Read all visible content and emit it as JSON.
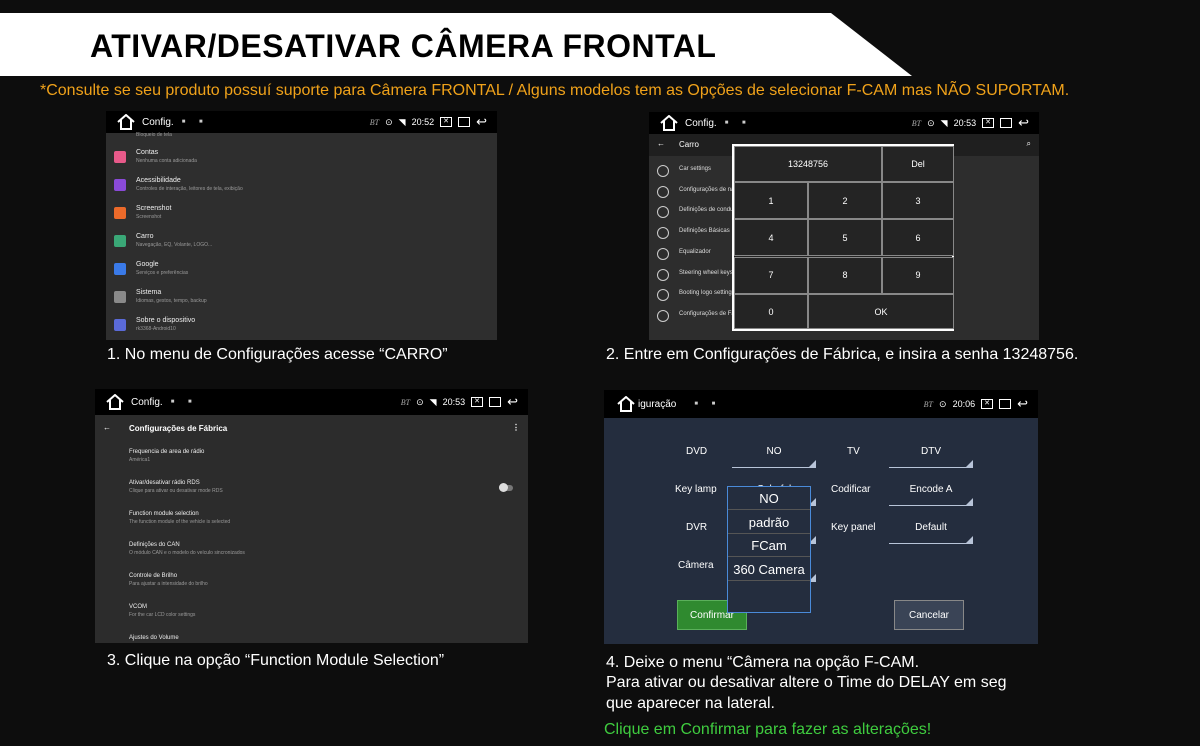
{
  "header": {
    "title": "ATIVAR/DESATIVAR CÂMERA FRONTAL",
    "notice": "*Consulte se seu produto possuí suporte para Câmera FRONTAL / Alguns modelos tem as Opções de selecionar F-CAM mas NÃO SUPORTAM."
  },
  "step1": {
    "status": {
      "title": "Config.",
      "time": "20:52",
      "bt": "BT"
    },
    "partial_top": "Bloqueio de tela",
    "items": [
      {
        "title": "Contas",
        "sub": "Nenhuma conta adicionada",
        "color": "#e85a8a"
      },
      {
        "title": "Acessibilidade",
        "sub": "Controles de interação, leitores de tela, exibição",
        "color": "#8a4ad8"
      },
      {
        "title": "Screenshot",
        "sub": "Screenshot",
        "color": "#ec6a2a"
      },
      {
        "title": "Carro",
        "sub": "Navegação, EQ, Volante, LOGO...",
        "color": "#3aa877"
      },
      {
        "title": "Google",
        "sub": "Serviços e preferências",
        "color": "#3a7ae8"
      },
      {
        "title": "Sistema",
        "sub": "Idiomas, gestos, tempo, backup",
        "color": "#8a8a8a"
      },
      {
        "title": "Sobre o dispositivo",
        "sub": "rk3368-Android10",
        "color": "#5a6ad8"
      }
    ],
    "caption": "1. No menu de Configurações acesse “CARRO”"
  },
  "step2": {
    "status": {
      "title": "Config.",
      "time": "20:53",
      "bt": "BT"
    },
    "header": "Carro",
    "items": [
      "Car settings",
      "Configurações de navegação",
      "Definições de condução",
      "Definições Básicas",
      "Equalizador",
      "Steering wheel keys",
      "Booting logo settings",
      "Configurações de Fábrica"
    ],
    "keypad": {
      "display": "13248756",
      "del": "Del",
      "keys": [
        "1",
        "2",
        "3",
        "4",
        "5",
        "6",
        "7",
        "8",
        "9"
      ],
      "zero": "0",
      "ok": "OK"
    },
    "caption": "2. Entre em Configurações de Fábrica, e insira a senha 13248756."
  },
  "step3": {
    "status": {
      "title": "Config.",
      "time": "20:53",
      "bt": "BT"
    },
    "header": "Configurações de Fábrica",
    "items": [
      {
        "title": "Frequencia de area de rádio",
        "sub": "América1"
      },
      {
        "title": "Ativar/desativar rádio RDS",
        "sub": "Clique para ativar ou desativar mode RDS"
      },
      {
        "title": "Function module selection",
        "sub": "The function module of the vehicle is selected"
      },
      {
        "title": "Definições do CAN",
        "sub": "O módulo CAN e o modelo do veículo sincronizados"
      },
      {
        "title": "Controle de Brilho",
        "sub": "Para ajustar a intensidade do brilho"
      },
      {
        "title": "VCOM",
        "sub": "For the car LCD color settings"
      },
      {
        "title": "Ajustes do Volume",
        "sub": ""
      }
    ],
    "caption": "3. Clique na opção “Function Module Selection”"
  },
  "step4": {
    "status": {
      "title": "iguração",
      "time": "20:06",
      "bt": "BT"
    },
    "fields": {
      "dvd_label": "DVD",
      "dvd_value": "NO",
      "tv_label": "TV",
      "tv_value": "DTV",
      "keylamp_label": "Key lamp",
      "keylamp_value": "Colorful",
      "codificar_label": "Codificar",
      "codificar_value": "Encode A",
      "dvr_label": "DVR",
      "keypanel_label": "Key panel",
      "keypanel_value": "Default",
      "camera_label": "Câmera",
      "camera_value": "NO"
    },
    "dropdown": [
      "NO",
      "padrão",
      "FCam",
      "360 Camera"
    ],
    "confirm": "Confirmar",
    "cancel": "Cancelar",
    "caption_lines": [
      "4. Deixe o menu “Câmera na opção F-CAM.",
      "Para ativar ou desativar altere o Time do DELAY em seg",
      "que aparecer na lateral."
    ],
    "caption_green": "Clique em Confirmar para fazer as alterações!"
  }
}
